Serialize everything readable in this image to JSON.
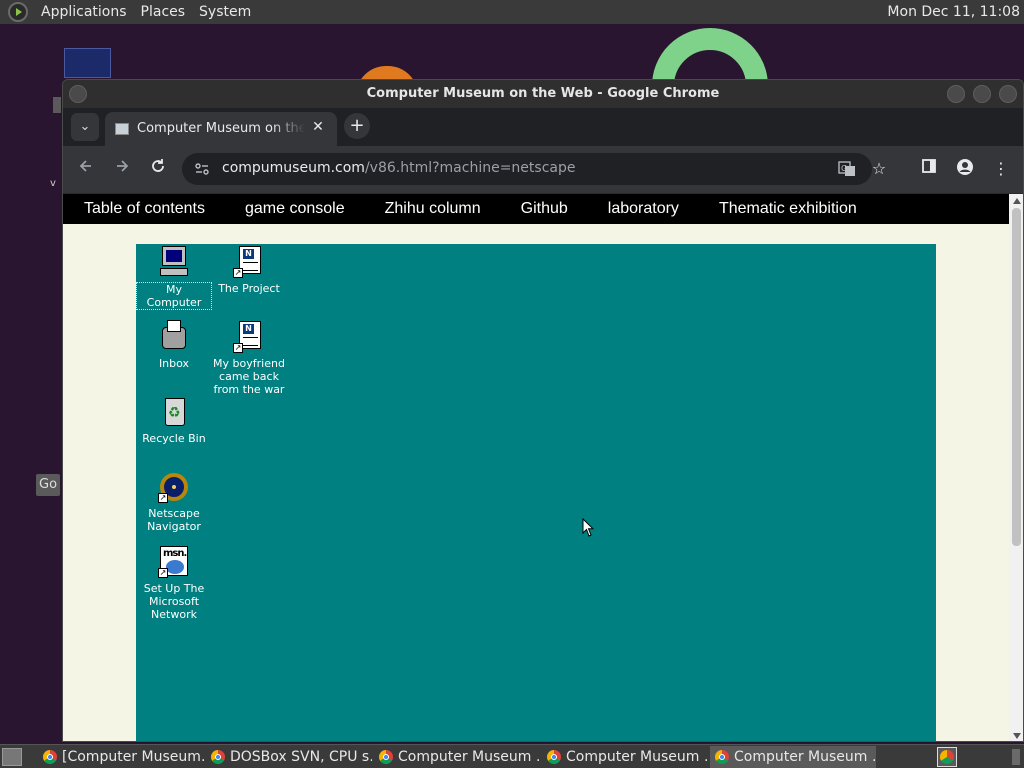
{
  "top_panel": {
    "menus": [
      "Applications",
      "Places",
      "System"
    ],
    "clock": "Mon Dec 11, 11:08"
  },
  "desktop": {
    "partial_label_go": "Go",
    "partial_label_v": "v"
  },
  "window": {
    "title": "Computer Museum on the Web - Google Chrome"
  },
  "tabs": {
    "active_title": "Computer Museum on the Web",
    "close_glyph": "✕",
    "new_tab_glyph": "+",
    "search_glyph": "⌄"
  },
  "toolbar": {
    "url_host": "compumuseum.com",
    "url_path": "/v86.html?machine=netscape",
    "icons": [
      "back-arrow",
      "forward-arrow",
      "reload",
      "site-info",
      "translate",
      "bookmark-star",
      "side-panel",
      "profile",
      "menu-kebab"
    ]
  },
  "site_nav": {
    "links": [
      "Table of contents",
      "game console",
      "Zhihu column",
      "Github",
      "laboratory",
      "Thematic exhibition"
    ]
  },
  "emulator": {
    "background": "#008080",
    "icons": [
      {
        "label": "My Computer",
        "art": "computer-icon"
      },
      {
        "label": "The Project",
        "art": "document-shortcut-icon"
      },
      {
        "label": "Inbox",
        "art": "inbox-icon"
      },
      {
        "label": "My boyfriend came back from the war",
        "art": "document-shortcut-icon"
      },
      {
        "label": "Recycle Bin",
        "art": "recycle-bin-icon"
      },
      {
        "label": "Netscape Navigator",
        "art": "netscape-wheel-icon"
      },
      {
        "label": "Set Up The Microsoft Network",
        "art": "msn-icon"
      }
    ]
  },
  "taskbar": {
    "tasks": [
      {
        "label": "[Computer Museum…",
        "active": false
      },
      {
        "label": "DOSBox SVN, CPU s…",
        "active": false
      },
      {
        "label": "Computer Museum …",
        "active": false
      },
      {
        "label": "Computer Museum …",
        "active": false
      },
      {
        "label": "Computer Museum …",
        "active": true
      }
    ]
  }
}
